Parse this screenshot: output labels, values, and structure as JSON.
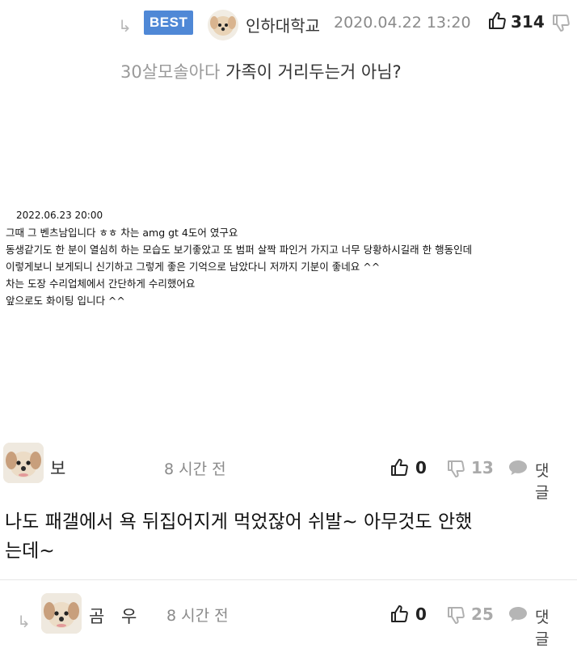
{
  "best_comment": {
    "badge": "BEST",
    "author": "인하대학교",
    "timestamp": "2020.04.22 13:20",
    "likes": "314",
    "mention": "30살모솔아다",
    "text": " 가족이 거리두는거 아님?"
  },
  "photo_caption": {
    "date": "2022.06.23 20:00",
    "lines": [
      "그때 그 벤츠남입니다 ㅎㅎ 차는 amg gt 4도어 였구요",
      "동생같기도 한 분이 열심히 하는 모습도 보기좋았고 또 범퍼 살짝 파인거 가지고 너무 당황하시길래 한 행동인데",
      "이렇게보니 보게되니 신기하고 그렇게 좋은 기억으로 남았다니 저까지 기분이 좋네요 ^^",
      "차는 도장 수리업체에서 간단하게 수리했어요",
      "앞으로도 화이팅 입니다 ^^"
    ]
  },
  "comment_1": {
    "author": "보",
    "time": "8 시간 전",
    "likes": "0",
    "dislikes": "13",
    "reply_label": "댓글",
    "text_line1": "나도 패갤에서 욕 뒤집어지게 먹었잖어 쉬발~ 아무것도 안했",
    "text_line2": "는데~"
  },
  "comment_2": {
    "author": "곰 우",
    "time": "8 시간 전",
    "likes": "0",
    "dislikes": "25",
    "reply_label": "댓글"
  },
  "colors": {
    "badge": "#4f88d6",
    "muted": "#8a8a8a",
    "divider": "#e6e6e6"
  },
  "icons": [
    "reply-arrow-icon",
    "thumbs-up-icon",
    "thumbs-down-icon",
    "speech-bubble-icon",
    "avatar-dog"
  ]
}
